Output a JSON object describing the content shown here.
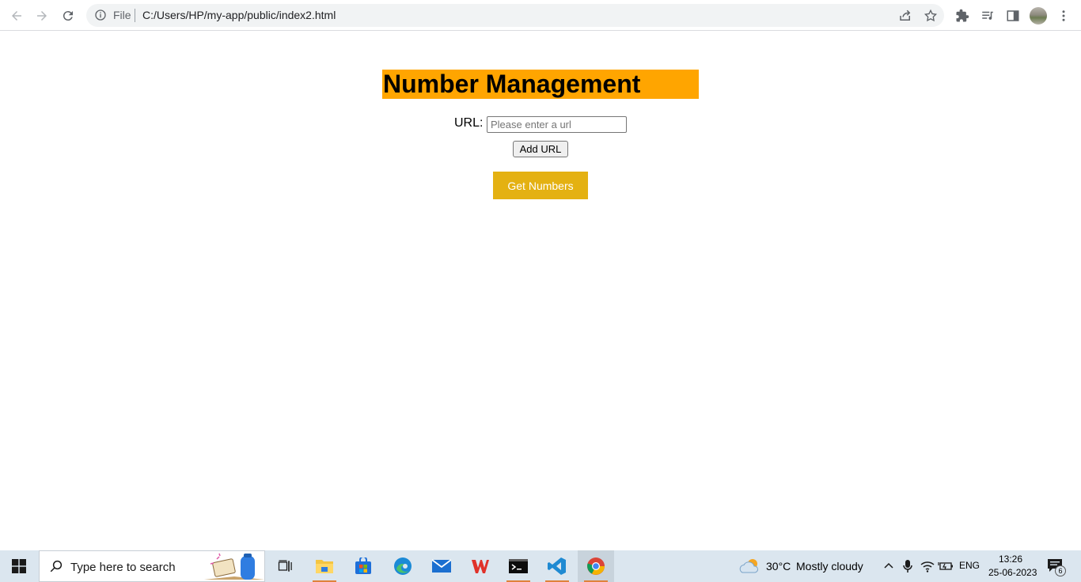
{
  "browser": {
    "scheme_label": "File",
    "url": "C:/Users/HP/my-app/public/index2.html"
  },
  "page": {
    "title": "Number Management",
    "url_label": "URL:",
    "url_placeholder": "Please enter a url",
    "add_url_button": "Add URL",
    "get_numbers_button": "Get Numbers",
    "title_bg_color": "#ffa500",
    "button_color": "#e4b112"
  },
  "taskbar": {
    "search_placeholder": "Type here to search",
    "apps": [
      "task-view",
      "file-explorer",
      "microsoft-store",
      "edge",
      "mail",
      "wps-office",
      "terminal",
      "vs-code",
      "chrome"
    ],
    "weather_temp": "30°C",
    "weather_desc": "Mostly cloudy",
    "language": "ENG",
    "time": "13:26",
    "date": "25-06-2023",
    "notification_count": "6"
  }
}
